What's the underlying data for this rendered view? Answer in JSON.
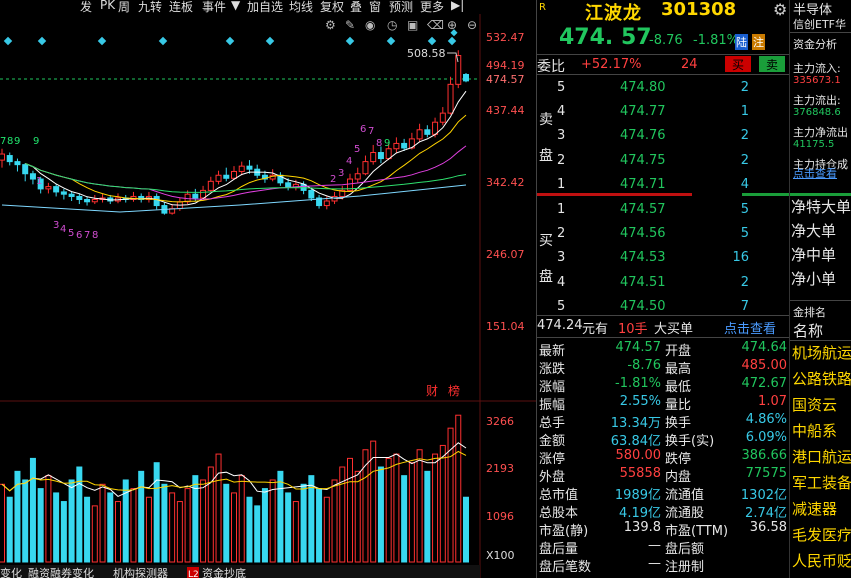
{
  "toolbar": {
    "items": [
      "发",
      "PK",
      "周",
      "九转",
      "连板",
      "事件",
      "▼",
      "加自选",
      "均线",
      "复权",
      "叠",
      "窗",
      "预测",
      "更多"
    ]
  },
  "stock": {
    "name": "江波龙",
    "code": "301308",
    "price": "474. 57",
    "change": "-8.76",
    "change_pct": "-1.81%",
    "badges": [
      "陆",
      "注"
    ]
  },
  "weibi": {
    "label": "委比",
    "value": "+52.17%",
    "diff": "24",
    "buy_btn": "买",
    "sell_btn": "卖"
  },
  "asks": [
    {
      "level": "5",
      "price": "474.80",
      "vol": "2"
    },
    {
      "level": "4",
      "price": "474.77",
      "vol": "1"
    },
    {
      "level": "3",
      "price": "474.76",
      "vol": "2"
    },
    {
      "level": "2",
      "price": "474.75",
      "vol": "2"
    },
    {
      "level": "1",
      "price": "474.71",
      "vol": "4"
    }
  ],
  "bids": [
    {
      "level": "1",
      "price": "474.57",
      "vol": "5"
    },
    {
      "level": "2",
      "price": "474.56",
      "vol": "5"
    },
    {
      "level": "3",
      "price": "474.53",
      "vol": "16"
    },
    {
      "level": "4",
      "price": "474.51",
      "vol": "2"
    },
    {
      "level": "5",
      "price": "474.50",
      "vol": "7"
    }
  ],
  "ask_label": [
    "卖",
    "盘"
  ],
  "bid_label": [
    "买",
    "盘"
  ],
  "big_order": {
    "price": "474.24",
    "unit": "元有",
    "qty": "10手",
    "type": "大买单",
    "link": "点击查看"
  },
  "stats": [
    {
      "l1": "最新",
      "v1": "474.57",
      "c1": "g",
      "l2": "开盘",
      "v2": "474.64",
      "c2": "g"
    },
    {
      "l1": "涨跌",
      "v1": "-8.76",
      "c1": "g",
      "l2": "最高",
      "v2": "485.00",
      "c2": "r"
    },
    {
      "l1": "涨幅",
      "v1": "-1.81%",
      "c1": "g",
      "l2": "最低",
      "v2": "472.67",
      "c2": "g"
    },
    {
      "l1": "振幅",
      "v1": "2.55%",
      "c1": "c",
      "l2": "量比",
      "v2": "1.07",
      "c2": "r"
    },
    {
      "l1": "总手",
      "v1": "13.34万",
      "c1": "c",
      "l2": "换手",
      "v2": "4.86%",
      "c2": "c"
    },
    {
      "l1": "金额",
      "v1": "63.84亿",
      "c1": "c",
      "l2": "换手(实)",
      "v2": "6.09%",
      "c2": "c"
    },
    {
      "l1": "涨停",
      "v1": "580.00",
      "c1": "r",
      "l2": "跌停",
      "v2": "386.66",
      "c2": "g"
    },
    {
      "l1": "外盘",
      "v1": "55858",
      "c1": "r",
      "l2": "内盘",
      "v2": "77575",
      "c2": "g"
    },
    {
      "l1": "总市值",
      "v1": "1989亿",
      "c1": "c",
      "l2": "流通值",
      "v2": "1302亿",
      "c2": "c"
    },
    {
      "l1": "总股本",
      "v1": "4.19亿",
      "c1": "c",
      "l2": "流通股",
      "v2": "2.74亿",
      "c2": "c"
    },
    {
      "l1": "市盈(静)",
      "v1": "139.8",
      "c1": "w",
      "l2": "市盈(TTM)",
      "v2": "36.58",
      "c2": "w"
    },
    {
      "l1": "盘后量",
      "v1": "—",
      "c1": "w",
      "l2": "盘后额",
      "v2": "",
      "c2": "w"
    },
    {
      "l1": "盘后笔数",
      "v1": "—",
      "c1": "w",
      "l2": "注册制",
      "v2": "",
      "c2": "w"
    }
  ],
  "side": {
    "sector": "半导体",
    "etf": "信创ETF华",
    "fund_title": "资金分析",
    "flows": [
      {
        "label": "主力流入:",
        "value": "335673.1",
        "color": "r"
      },
      {
        "label": "主力流出:",
        "value": "376848.6",
        "color": "g"
      },
      {
        "label": "主力净流出",
        "value": "41175.5",
        "color": "g"
      },
      {
        "label": "主力持仓成",
        "value": "",
        "color": "w"
      }
    ],
    "link": "点击查看",
    "orders": [
      "净特大单",
      "净大单",
      "净中单",
      "净小单"
    ],
    "rank_title": "金排名",
    "name_header": "名称",
    "concepts": [
      "机场航运",
      "公路铁路",
      "国资云",
      "中船系",
      "港口航运",
      "军工装备",
      "减速器",
      "毛发医疗",
      "人民币贬"
    ]
  },
  "chart_data": {
    "type": "candlestick",
    "price_axis": {
      "ticks": [
        "532.47",
        "494.19",
        "474.57",
        "437.44",
        "342.42",
        "246.07",
        "151.04"
      ]
    },
    "volume_axis": {
      "ticks": [
        "3266",
        "2193",
        "1096",
        "X100"
      ]
    },
    "annotations": {
      "high_label": "508.58",
      "badges": [
        "财",
        "榜"
      ]
    },
    "td_sequence_labels": [
      "7",
      "8",
      "9",
      "1",
      "3",
      "4",
      "5",
      "6",
      "7",
      "8",
      "9",
      "2",
      "3",
      "4",
      "5",
      "6",
      "7",
      "8",
      "9"
    ],
    "candles": [
      [
        370,
        378,
        360,
        385,
        358
      ],
      [
        376,
        368,
        363,
        380,
        362
      ],
      [
        368,
        364,
        355,
        372,
        352
      ],
      [
        364,
        352,
        342,
        366,
        338
      ],
      [
        352,
        345,
        338,
        356,
        335
      ],
      [
        345,
        332,
        326,
        348,
        320
      ],
      [
        332,
        335,
        326,
        340,
        322
      ],
      [
        335,
        328,
        322,
        338,
        318
      ],
      [
        328,
        325,
        318,
        332,
        316
      ],
      [
        325,
        322,
        316,
        328,
        314
      ],
      [
        322,
        318,
        312,
        326,
        310
      ],
      [
        318,
        315,
        310,
        322,
        308
      ],
      [
        315,
        318,
        312,
        324,
        310
      ],
      [
        318,
        320,
        314,
        326,
        312
      ],
      [
        320,
        316,
        312,
        324,
        310
      ],
      [
        316,
        320,
        313,
        326,
        310
      ],
      [
        320,
        318,
        314,
        324,
        312
      ],
      [
        318,
        322,
        315,
        328,
        312
      ],
      [
        322,
        318,
        314,
        326,
        312
      ],
      [
        318,
        322,
        314,
        328,
        310
      ],
      [
        322,
        310,
        305,
        326,
        300
      ],
      [
        310,
        300,
        298,
        314,
        294
      ],
      [
        300,
        306,
        298,
        312,
        296
      ],
      [
        306,
        315,
        303,
        320,
        300
      ],
      [
        315,
        325,
        312,
        330,
        310
      ],
      [
        325,
        320,
        316,
        332,
        314
      ],
      [
        320,
        330,
        318,
        336,
        316
      ],
      [
        330,
        342,
        328,
        348,
        326
      ],
      [
        342,
        350,
        338,
        356,
        334
      ],
      [
        350,
        346,
        342,
        360,
        340
      ],
      [
        346,
        355,
        344,
        362,
        340
      ],
      [
        355,
        362,
        350,
        368,
        348
      ],
      [
        362,
        358,
        352,
        370,
        350
      ],
      [
        358,
        350,
        346,
        364,
        344
      ],
      [
        350,
        345,
        340,
        356,
        338
      ],
      [
        345,
        350,
        342,
        358,
        340
      ],
      [
        350,
        340,
        336,
        354,
        332
      ],
      [
        340,
        334,
        330,
        346,
        326
      ],
      [
        334,
        338,
        330,
        344,
        328
      ],
      [
        338,
        330,
        325,
        342,
        322
      ],
      [
        330,
        320,
        316,
        334,
        312
      ],
      [
        320,
        310,
        306,
        324,
        302
      ],
      [
        310,
        316,
        305,
        322,
        300
      ],
      [
        316,
        322,
        312,
        328,
        308
      ],
      [
        322,
        330,
        318,
        336,
        316
      ],
      [
        330,
        345,
        328,
        352,
        326
      ],
      [
        345,
        352,
        340,
        360,
        338
      ],
      [
        352,
        368,
        350,
        376,
        348
      ],
      [
        368,
        380,
        364,
        390,
        360
      ],
      [
        380,
        372,
        366,
        388,
        362
      ],
      [
        372,
        385,
        370,
        392,
        368
      ],
      [
        385,
        392,
        380,
        400,
        378
      ],
      [
        392,
        386,
        382,
        398,
        378
      ],
      [
        386,
        398,
        384,
        406,
        380
      ],
      [
        398,
        410,
        394,
        418,
        390
      ],
      [
        410,
        404,
        400,
        416,
        396
      ],
      [
        404,
        420,
        400,
        426,
        398
      ],
      [
        420,
        432,
        416,
        440,
        412
      ],
      [
        432,
        470,
        430,
        480,
        428
      ],
      [
        470,
        508,
        465,
        515,
        460
      ],
      [
        483,
        474.57,
        472.67,
        485,
        472.67
      ]
    ],
    "volumes": [
      1800,
      1500,
      2100,
      1900,
      2400,
      1700,
      2000,
      1600,
      1400,
      1900,
      2200,
      1500,
      1300,
      1800,
      1600,
      1400,
      1900,
      1700,
      2100,
      1500,
      2300,
      1800,
      1600,
      1400,
      1700,
      2000,
      1900,
      2200,
      2500,
      1800,
      1600,
      2000,
      1500,
      1300,
      1700,
      1900,
      2100,
      1600,
      1400,
      1800,
      2000,
      1700,
      1500,
      1900,
      2200,
      2400,
      2100,
      2600,
      2800,
      2200,
      2400,
      2500,
      2000,
      2300,
      2600,
      2100,
      2500,
      2700,
      3100,
      3400,
      1500
    ]
  }
}
